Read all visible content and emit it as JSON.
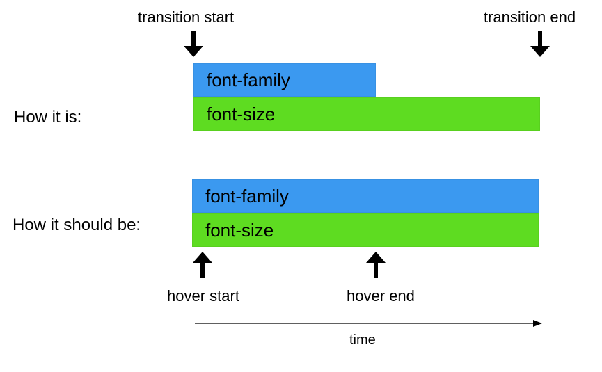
{
  "labels": {
    "transition_start": "transition start",
    "transition_end": "transition end",
    "how_it_is": "How it is:",
    "how_it_should_be": "How it should  be:",
    "hover_start": "hover start",
    "hover_end": "hover end",
    "time": "time"
  },
  "bars": {
    "row1_top": "font-family",
    "row1_bottom": "font-size",
    "row2_top": "font-family",
    "row2_bottom": "font-size"
  },
  "colors": {
    "blue": "#3b99f0",
    "green": "#5edc21"
  },
  "chart_data": {
    "type": "bar",
    "title": "",
    "xlabel": "time",
    "ylabel": "",
    "x_range": [
      0,
      500
    ],
    "markers": {
      "transition_start": 0,
      "transition_end": 498,
      "hover_start": 0,
      "hover_end": 262
    },
    "series": [
      {
        "name": "How it is",
        "bars": [
          {
            "label": "font-family",
            "start": 0,
            "duration": 262,
            "color": "#3b99f0"
          },
          {
            "label": "font-size",
            "start": 0,
            "duration": 498,
            "color": "#5edc21"
          }
        ]
      },
      {
        "name": "How it should be",
        "bars": [
          {
            "label": "font-family",
            "start": 0,
            "duration": 498,
            "color": "#3b99f0"
          },
          {
            "label": "font-size",
            "start": 0,
            "duration": 498,
            "color": "#5edc21"
          }
        ]
      }
    ]
  }
}
